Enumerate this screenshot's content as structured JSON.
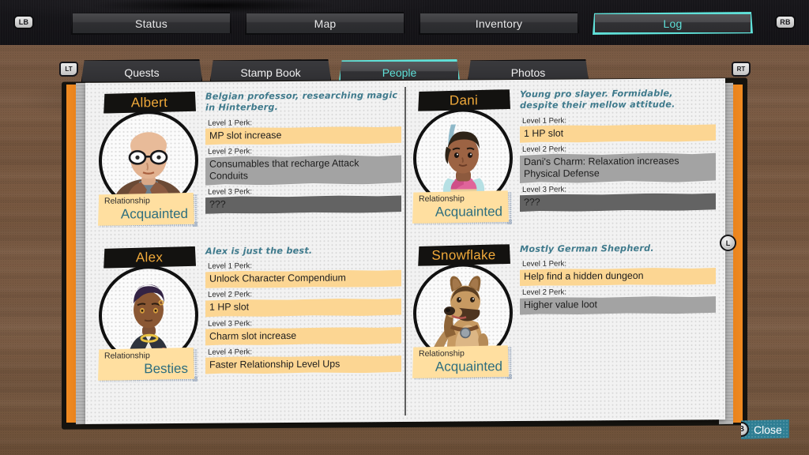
{
  "topbar": {
    "left_bumper": "LB",
    "right_bumper": "RB",
    "tabs": [
      {
        "label": "Status",
        "active": false
      },
      {
        "label": "Map",
        "active": false
      },
      {
        "label": "Inventory",
        "active": false
      },
      {
        "label": "Log",
        "active": true
      }
    ]
  },
  "subtabs": {
    "left_trigger": "LT",
    "right_trigger": "RT",
    "tabs": [
      {
        "label": "Quests",
        "active": false
      },
      {
        "label": "Stamp Book",
        "active": false
      },
      {
        "label": "People",
        "active": true
      },
      {
        "label": "Photos",
        "active": false
      }
    ]
  },
  "scroll_indicator": {
    "glyph": "L"
  },
  "footer": {
    "close_glyph": "B",
    "close_label": "Close"
  },
  "relationship_label": "Relationship",
  "people": [
    {
      "name": "Albert",
      "blurb": "Belgian professor, researching magic in Hinterberg.",
      "relationship_label": "Relationship",
      "relationship_value": "Acquainted",
      "perks": [
        {
          "label": "Level 1 Perk:",
          "value": "MP slot increase",
          "state": "unlocked"
        },
        {
          "label": "Level 2 Perk:",
          "value": "Consumables that recharge Attack Conduits",
          "state": "locked1"
        },
        {
          "label": "Level 3 Perk:",
          "value": "???",
          "state": "locked2"
        }
      ]
    },
    {
      "name": "Dani",
      "blurb": "Young pro slayer. Formidable, despite their mellow attitude.",
      "relationship_label": "Relationship",
      "relationship_value": "Acquainted",
      "perks": [
        {
          "label": "Level 1 Perk:",
          "value": "1 HP slot",
          "state": "unlocked"
        },
        {
          "label": "Level 2 Perk:",
          "value": "Dani's Charm: Relaxation increases Physical Defense",
          "state": "locked1"
        },
        {
          "label": "Level 3 Perk:",
          "value": "???",
          "state": "locked2"
        }
      ]
    },
    {
      "name": "Alex",
      "blurb": "Alex is just the best.",
      "relationship_label": "Relationship",
      "relationship_value": "Besties",
      "perks": [
        {
          "label": "Level 1 Perk:",
          "value": "Unlock Character Compendium",
          "state": "unlocked"
        },
        {
          "label": "Level 2 Perk:",
          "value": "1 HP slot",
          "state": "unlocked"
        },
        {
          "label": "Level 3 Perk:",
          "value": "Charm slot increase",
          "state": "unlocked"
        },
        {
          "label": "Level 4 Perk:",
          "value": "Faster Relationship Level Ups",
          "state": "unlocked"
        }
      ]
    },
    {
      "name": "Snowflake",
      "blurb": "Mostly German Shepherd.",
      "relationship_label": "Relationship",
      "relationship_value": "Acquainted",
      "perks": [
        {
          "label": "Level 1 Perk:",
          "value": "Help find a hidden dungeon",
          "state": "unlocked"
        },
        {
          "label": "Level 2 Perk:",
          "value": "Higher value loot",
          "state": "locked1"
        }
      ]
    }
  ],
  "colors": {
    "accent_cyan": "#5fe0d8",
    "nameplate_text": "#f0a93a",
    "blurb_text": "#3f7a8c",
    "perk_unlocked": "#fcd693",
    "perk_locked_light": "#a3a3a3",
    "perk_locked_dark": "#636363",
    "sticky_note": "#ffdfa0",
    "binding_orange": "#f08a21",
    "close_button": "#2e7e93"
  }
}
